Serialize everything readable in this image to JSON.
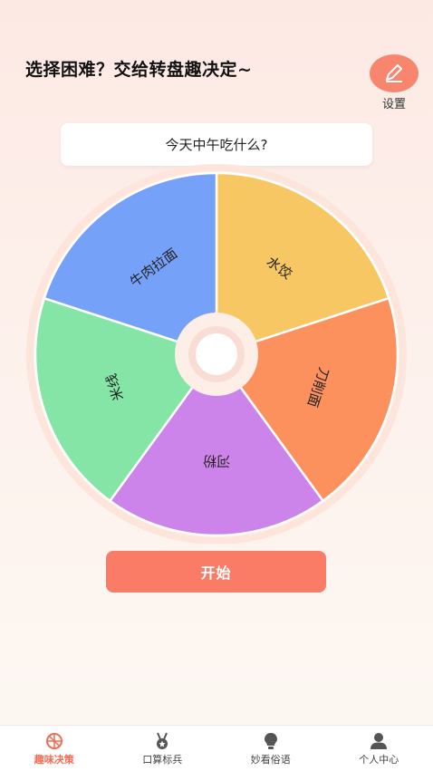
{
  "header": {
    "headline": "选择困难？交给转盘趣决定~",
    "settings_label": "设置"
  },
  "question": "今天中午吃什么?",
  "wheel": {
    "segments": [
      {
        "label": "水饺",
        "color": "#f6c762"
      },
      {
        "label": "刀削面",
        "color": "#fd915e"
      },
      {
        "label": "河粉",
        "color": "#cd84ea"
      },
      {
        "label": "米线",
        "color": "#84e5a6"
      },
      {
        "label": "牛肉拉面",
        "color": "#76a1f8"
      }
    ]
  },
  "start_label": "开始",
  "tabs": [
    {
      "label": "趣味决策",
      "icon": "wheel-icon",
      "active": true
    },
    {
      "label": "口算标兵",
      "icon": "medal-icon",
      "active": false
    },
    {
      "label": "妙看俗语",
      "icon": "bulb-icon",
      "active": false
    },
    {
      "label": "个人中心",
      "icon": "user-icon",
      "active": false
    }
  ],
  "colors": {
    "accent": "#fa7c66",
    "active_tab": "#f36a51"
  }
}
